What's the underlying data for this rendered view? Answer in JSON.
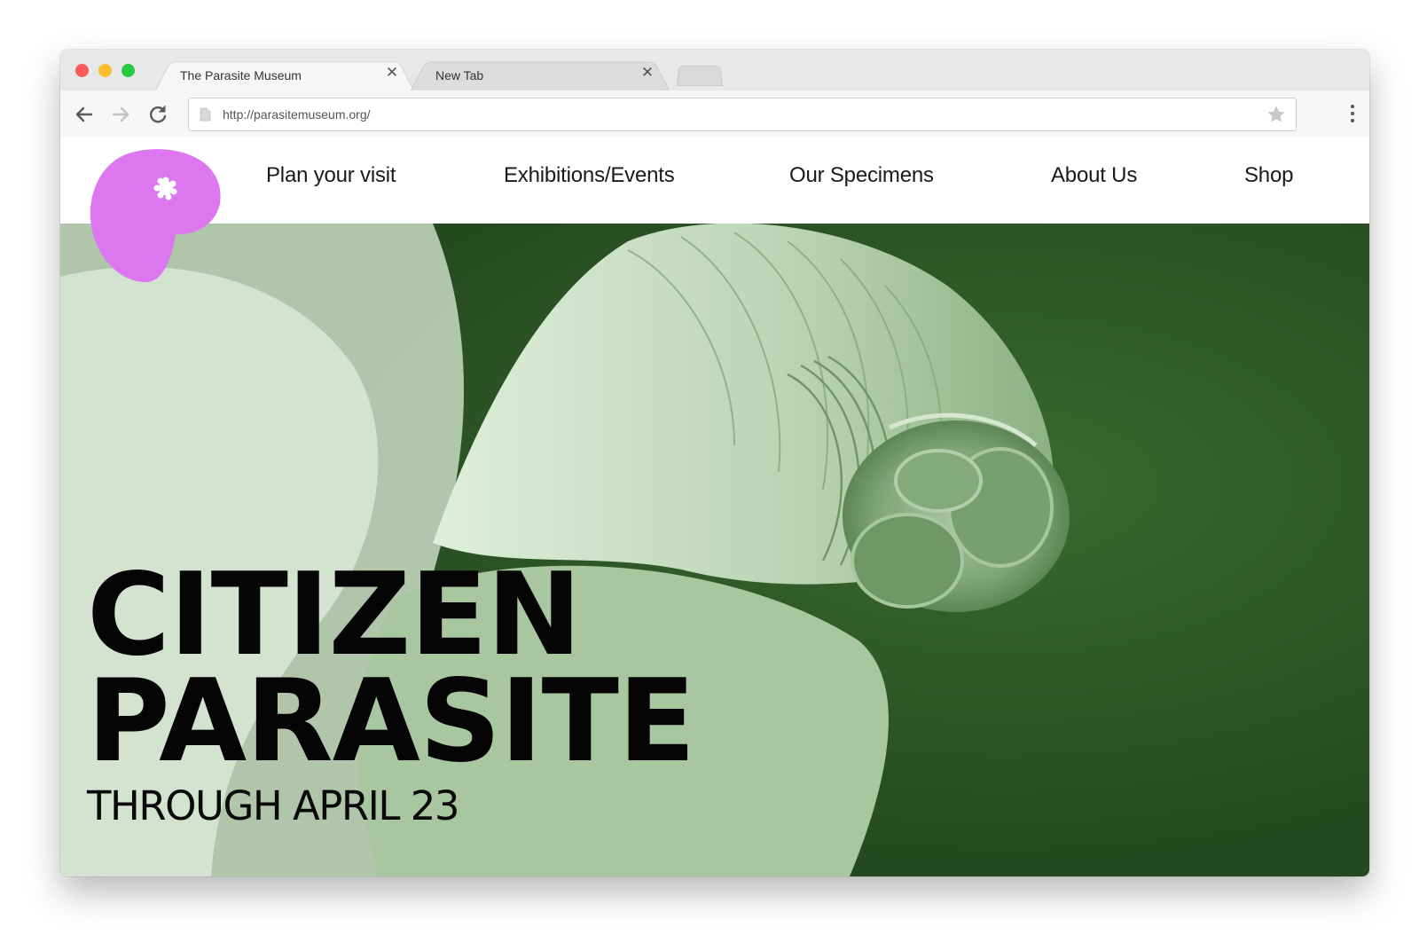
{
  "browser": {
    "tabs": [
      {
        "title": "The Parasite Museum",
        "close": "✕",
        "active": true
      },
      {
        "title": "New Tab",
        "close": "✕",
        "active": false
      }
    ],
    "url": "http://parasitemuseum.org/"
  },
  "site": {
    "logo": {
      "icon": "parasite-blob-logo",
      "color": "#dc77f0"
    },
    "nav": [
      {
        "label": "Plan your visit"
      },
      {
        "label": "Exhibitions/Events"
      },
      {
        "label": "Our Specimens"
      },
      {
        "label": "About Us"
      },
      {
        "label": "Shop"
      }
    ]
  },
  "hero": {
    "title_line1": "CITIZEN",
    "title_line2": "PARASITE",
    "subtitle": "THROUGH APRIL 23",
    "background_color": "#2d5526",
    "image": "green-tinted-worm-micrograph"
  }
}
